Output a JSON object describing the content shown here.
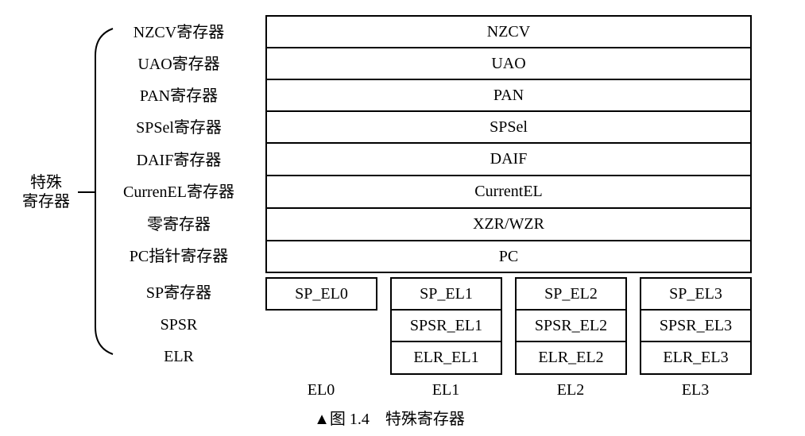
{
  "group_label_line1": "特殊",
  "group_label_line2": "寄存器",
  "row_labels": [
    "NZCV寄存器",
    "UAO寄存器",
    "PAN寄存器",
    "SPSel寄存器",
    "DAIF寄存器",
    "CurrenEL寄存器",
    "零寄存器",
    "PC指针寄存器"
  ],
  "row_values": [
    "NZCV",
    "UAO",
    "PAN",
    "SPSel",
    "DAIF",
    "CurrentEL",
    "XZR/WZR",
    "PC"
  ],
  "banked_labels": {
    "sp": "SP寄存器",
    "spsr": "SPSR",
    "elr": "ELR"
  },
  "el0": {
    "sp": "SP_EL0",
    "label": "EL0"
  },
  "el1": {
    "sp": "SP_EL1",
    "spsr": "SPSR_EL1",
    "elr": "ELR_EL1",
    "label": "EL1"
  },
  "el2": {
    "sp": "SP_EL2",
    "spsr": "SPSR_EL2",
    "elr": "ELR_EL2",
    "label": "EL2"
  },
  "el3": {
    "sp": "SP_EL3",
    "spsr": "SPSR_EL3",
    "elr": "ELR_EL3",
    "label": "EL3"
  },
  "caption": "▲图 1.4　特殊寄存器"
}
